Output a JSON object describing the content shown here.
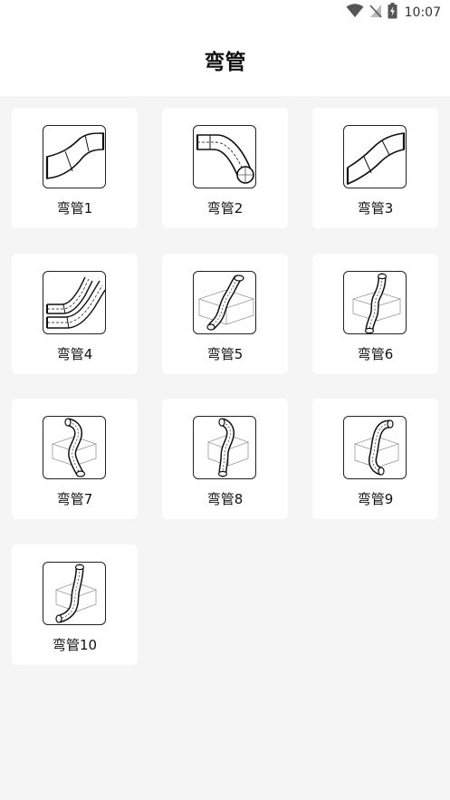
{
  "status_bar": {
    "time": "10:07",
    "icons": [
      "wifi-icon",
      "no-sim-icon",
      "battery-icon"
    ]
  },
  "header": {
    "title": "弯管"
  },
  "items": [
    {
      "label": "弯管1",
      "icon": "s-bend-pipe-icon"
    },
    {
      "label": "弯管2",
      "icon": "elbow-pipe-icon"
    },
    {
      "label": "弯管3",
      "icon": "s-bend-pipe-icon"
    },
    {
      "label": "弯管4",
      "icon": "parallel-bend-pipes-icon"
    },
    {
      "label": "弯管5",
      "icon": "3d-bent-pipe-icon"
    },
    {
      "label": "弯管6",
      "icon": "3d-bent-pipe-icon"
    },
    {
      "label": "弯管7",
      "icon": "3d-bent-pipe-icon"
    },
    {
      "label": "弯管8",
      "icon": "3d-bent-pipe-icon"
    },
    {
      "label": "弯管9",
      "icon": "3d-bent-pipe-icon"
    },
    {
      "label": "弯管10",
      "icon": "3d-bent-pipe-icon"
    }
  ]
}
